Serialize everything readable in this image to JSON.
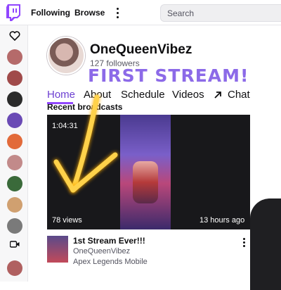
{
  "topbar": {
    "following_label": "Following",
    "browse_label": "Browse",
    "search_placeholder": "Search"
  },
  "sidebar": {
    "avatars": [
      {
        "name": "followed-channel-1",
        "color": "#b56a6a"
      },
      {
        "name": "followed-channel-2",
        "color": "#a04a4a"
      },
      {
        "name": "followed-channel-3",
        "color": "#2b2b2b"
      },
      {
        "name": "followed-channel-4",
        "color": "#6a4ab5"
      },
      {
        "name": "followed-channel-5",
        "color": "#e26a3a"
      },
      {
        "name": "followed-channel-6",
        "color": "#c28a8a"
      },
      {
        "name": "followed-channel-7",
        "color": "#3a6a3a"
      },
      {
        "name": "followed-channel-8",
        "color": "#d0a070"
      },
      {
        "name": "followed-channel-9",
        "color": "#7a7a7a"
      },
      {
        "name": "followed-channel-10",
        "color": "#b06060"
      }
    ]
  },
  "channel": {
    "name": "OneQueenVibez",
    "followers": "127 followers",
    "overlay_title": "FIRST STREAM!"
  },
  "tabs": [
    {
      "label": "Home",
      "active": true
    },
    {
      "label": "About",
      "active": false
    },
    {
      "label": "Schedule",
      "active": false
    },
    {
      "label": "Videos",
      "active": false
    },
    {
      "label": "Chat",
      "active": false,
      "icon": "external-arrow-icon"
    }
  ],
  "section": {
    "heading": "Recent broadcasts"
  },
  "video": {
    "duration": "1:04:31",
    "views": "78 views",
    "uploaded": "13 hours ago",
    "title": "1st Stream Ever!!!",
    "channel": "OneQueenVibez",
    "game": "Apex Legends Mobile"
  },
  "colors": {
    "accent": "#9147ff",
    "overlay_text": "#8c6ae8",
    "arrow": "#ffd24a"
  }
}
